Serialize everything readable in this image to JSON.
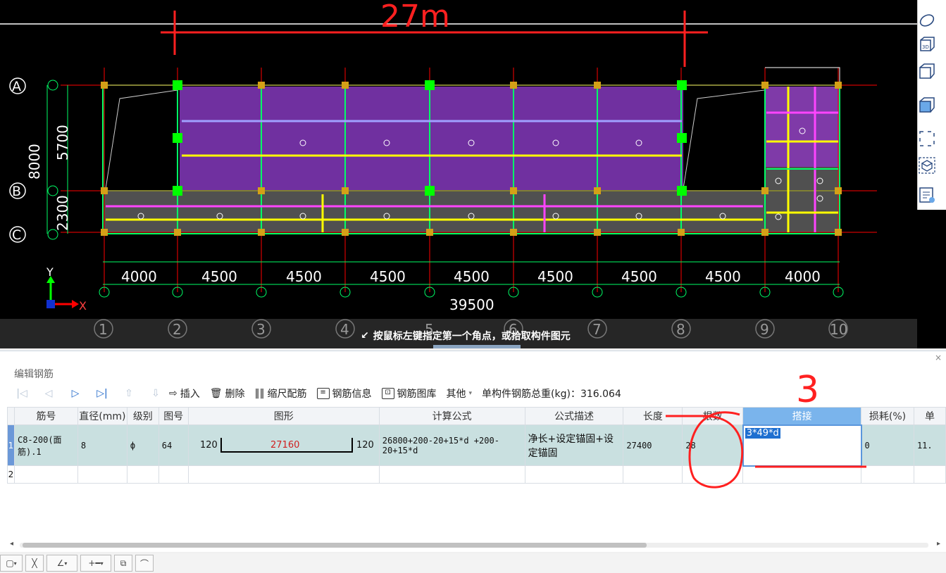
{
  "cad": {
    "annotation_top": "27m",
    "annotation_three": "3",
    "axis_rows": [
      "A",
      "B",
      "C"
    ],
    "dims_left": [
      "8000",
      "5700",
      "2300"
    ],
    "col_labels": [
      "1",
      "2",
      "3",
      "4",
      "5",
      "6",
      "7",
      "8",
      "9",
      "10"
    ],
    "bay_dims": [
      "4000",
      "4500",
      "4500",
      "4500",
      "4500",
      "4500",
      "4500",
      "4500",
      "4000"
    ],
    "total_dim": "39500",
    "axis_y": "Y",
    "axis_x": "X",
    "status_prompt": "按鼠标左键指定第一个角点，或拾取构件图元",
    "colors": {
      "slab": "#7030a0",
      "grid": "#ff0000",
      "beam": "#00ff00",
      "rebar_yellow": "#ffff00",
      "rebar_magenta": "#ff00ff"
    }
  },
  "view_toolbar": {
    "icons": [
      "orbit-icon",
      "3d-view-icon",
      "box-view-icon",
      "box-view-filled-icon",
      "select-region-icon",
      "cube-select-icon",
      "property-list-icon"
    ],
    "label_3d": "3D"
  },
  "panel": {
    "title": "编辑钢筋",
    "close": "×",
    "toolbar": {
      "insert": "插入",
      "delete": "删除",
      "scale_rebar": "缩尺配筋",
      "rebar_info": "钢筋信息",
      "rebar_library": "钢筋图库",
      "other": "其他",
      "total_weight": "单构件钢筋总重(kg)：316.064"
    },
    "columns": [
      "筋号",
      "直径(mm)",
      "级别",
      "图号",
      "图形",
      "计算公式",
      "公式描述",
      "长度",
      "根数",
      "搭接",
      "损耗(%)",
      "单"
    ],
    "rows": [
      {
        "num": "1",
        "bar_no": "C8-200(面筋).1",
        "diameter": "8",
        "grade": "ф",
        "fig_no": "64",
        "shape_left": "120",
        "shape_mid": "27160",
        "shape_right": "120",
        "formula": "26800+200-20+15*d +200-20+15*d",
        "desc": "净长+设定锚固+设定锚固",
        "length": "27400",
        "count": "28",
        "lap": "3*49*d",
        "loss": "0",
        "unit": "11."
      },
      {
        "num": "2"
      }
    ]
  }
}
